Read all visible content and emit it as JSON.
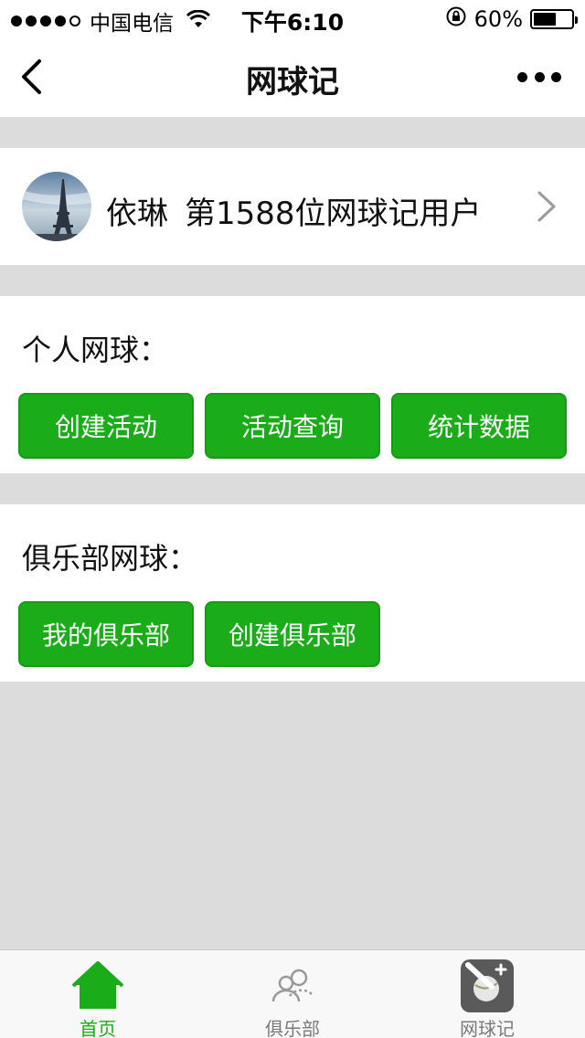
{
  "status_bar": {
    "carrier": "中国电信",
    "time": "下午6:10",
    "battery_text": "60%",
    "battery_level": 0.6
  },
  "nav": {
    "title": "网球记"
  },
  "profile": {
    "name": "依琳",
    "rank_text": "第1588位网球记用户"
  },
  "personal": {
    "title": "个人网球：",
    "buttons": [
      "创建活动",
      "活动查询",
      "统计数据"
    ]
  },
  "club": {
    "title": "俱乐部网球：",
    "buttons": [
      "我的俱乐部",
      "创建俱乐部"
    ]
  },
  "tabs": [
    {
      "label": "首页",
      "icon": "home-icon"
    },
    {
      "label": "俱乐部",
      "icon": "users-icon"
    },
    {
      "label": "网球记",
      "icon": "tennis-app-icon"
    }
  ],
  "colors": {
    "accent": "#1aad19",
    "tab_active": "#1aad19",
    "background": "#dcdcdc"
  }
}
